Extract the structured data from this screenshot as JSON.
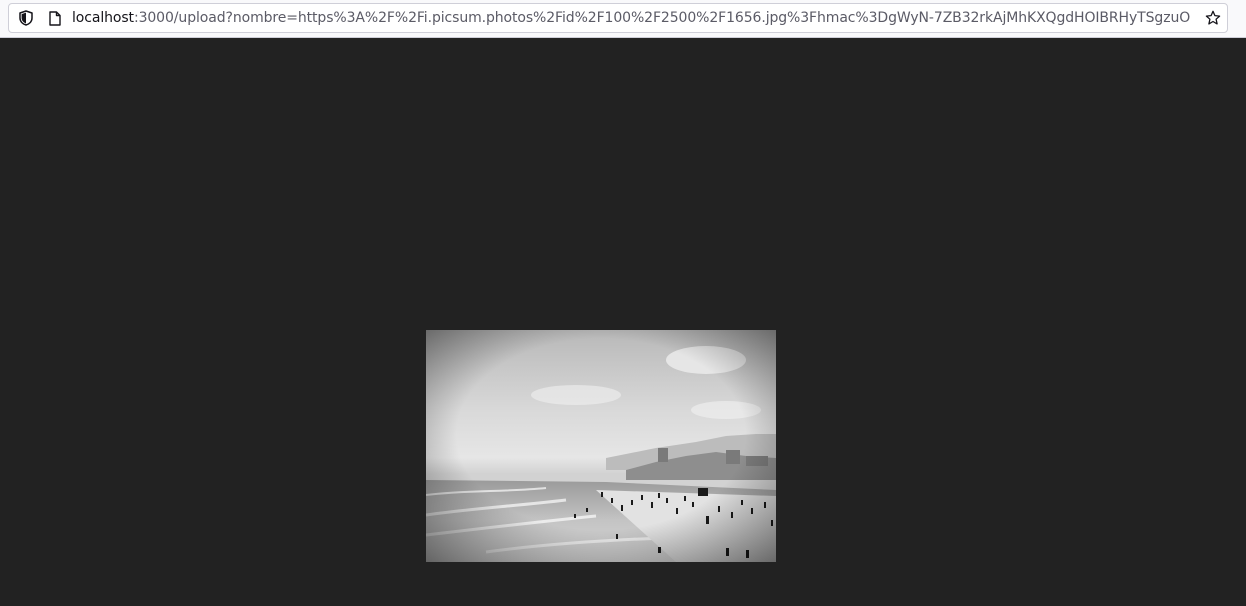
{
  "browser": {
    "url_host": "localhost",
    "url_rest": ":3000/upload?nombre=https%3A%2F%2Fi.picsum.photos%2Fid%2F100%2F2500%2F1656.jpg%3Fhmac%3DgWyN-7ZB32rkAjMhKXQgdHOIBRHyTSgzuO",
    "icons": {
      "security": "shield-icon",
      "page": "page-icon",
      "bookmark": "star-icon"
    }
  },
  "page": {
    "background_color": "#222222",
    "image": {
      "description_icon": "beach-photo",
      "style": "grayscale"
    }
  }
}
